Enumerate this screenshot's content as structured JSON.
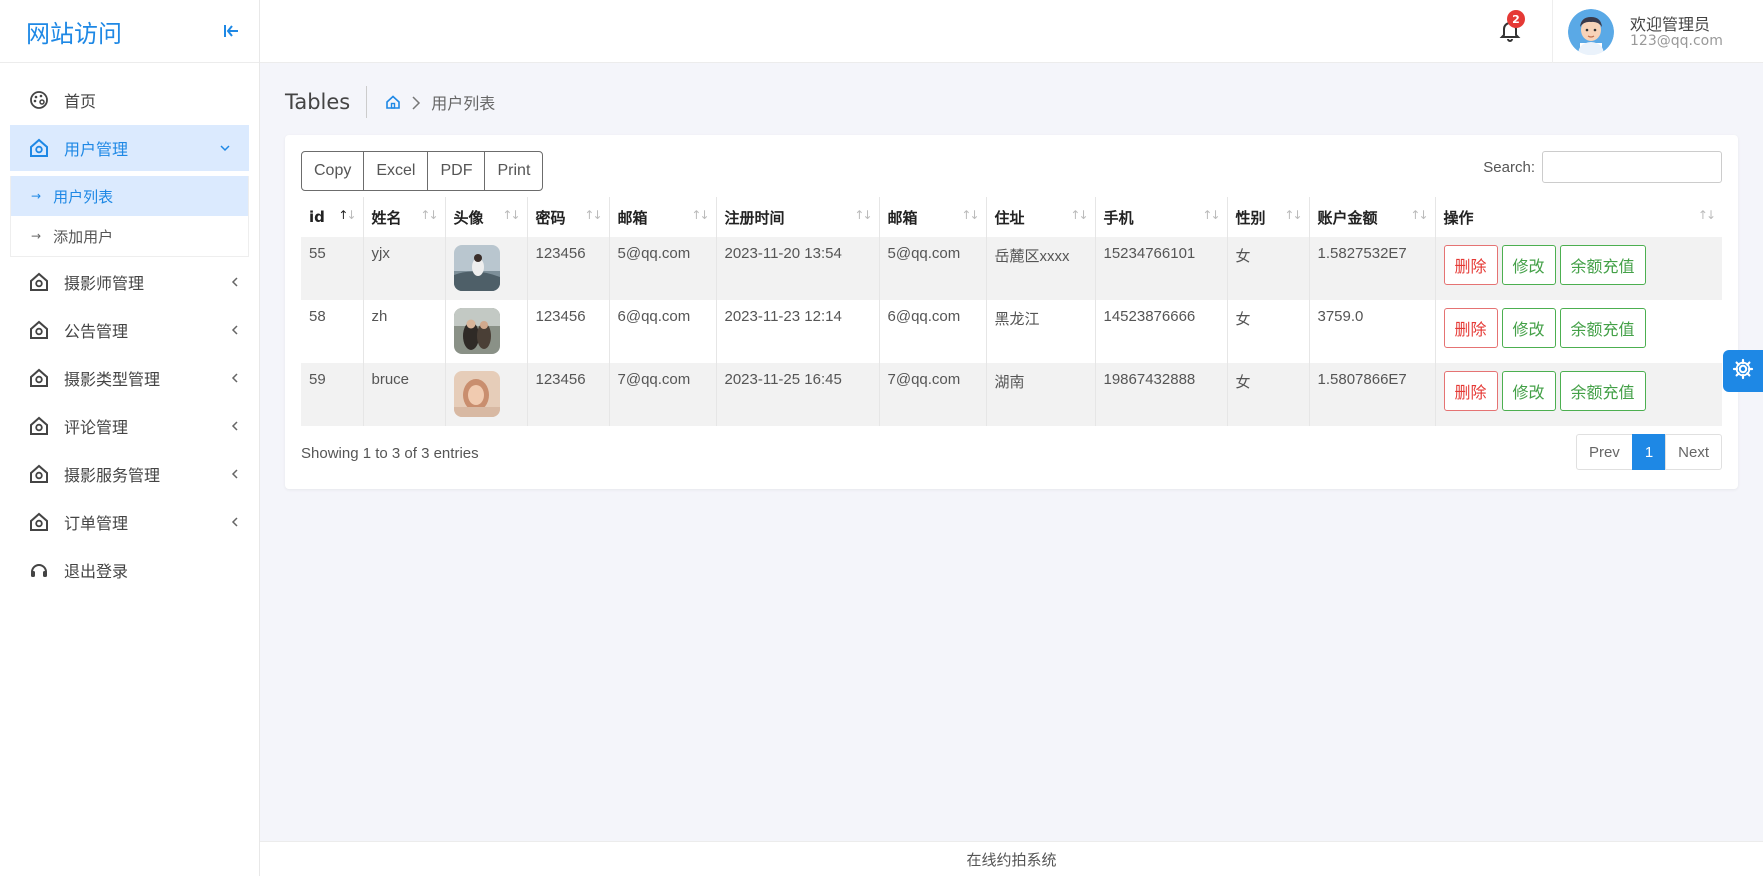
{
  "sidebar": {
    "brand": "网站访问",
    "items": [
      {
        "label": "首页",
        "icon": "palette-icon"
      },
      {
        "label": "用户管理",
        "icon": "home-icon",
        "active": true
      },
      {
        "label": "摄影师管理",
        "icon": "home-icon"
      },
      {
        "label": "公告管理",
        "icon": "home-icon"
      },
      {
        "label": "摄影类型管理",
        "icon": "home-icon"
      },
      {
        "label": "评论管理",
        "icon": "home-icon"
      },
      {
        "label": "摄影服务管理",
        "icon": "home-icon"
      },
      {
        "label": "订单管理",
        "icon": "home-icon"
      },
      {
        "label": "退出登录",
        "icon": "headset-icon"
      }
    ],
    "submenu": [
      {
        "label": "用户列表",
        "active": true
      },
      {
        "label": "添加用户"
      }
    ]
  },
  "header": {
    "notification_count": "2",
    "user_name": "欢迎管理员",
    "user_email": "123@qq.com"
  },
  "page": {
    "title": "Tables",
    "breadcrumb_current": "用户列表"
  },
  "toolbar": {
    "copy": "Copy",
    "excel": "Excel",
    "pdf": "PDF",
    "print": "Print",
    "search_label": "Search:"
  },
  "table": {
    "columns": [
      "id",
      "姓名",
      "头像",
      "密码",
      "邮箱",
      "注册时间",
      "邮箱",
      "住址",
      "手机",
      "性别",
      "账户金额",
      "操作"
    ],
    "rows": [
      {
        "id": "55",
        "name": "yjx",
        "password": "123456",
        "email": "5@qq.com",
        "reg_time": "2023-11-20 13:54",
        "email2": "5@qq.com",
        "address": "岳麓区xxxx",
        "phone": "15234766101",
        "gender": "女",
        "balance": "1.5827532E7"
      },
      {
        "id": "58",
        "name": "zh",
        "password": "123456",
        "email": "6@qq.com",
        "reg_time": "2023-11-23 12:14",
        "email2": "6@qq.com",
        "address": "黑龙江",
        "phone": "14523876666",
        "gender": "女",
        "balance": "3759.0"
      },
      {
        "id": "59",
        "name": "bruce",
        "password": "123456",
        "email": "7@qq.com",
        "reg_time": "2023-11-25 16:45",
        "email2": "7@qq.com",
        "address": "湖南",
        "phone": "19867432888",
        "gender": "女",
        "balance": "1.5807866E7"
      }
    ],
    "actions": {
      "delete": "删除",
      "edit": "修改",
      "recharge": "余额充值"
    }
  },
  "pagination": {
    "info": "Showing 1 to 3 of 3 entries",
    "prev": "Prev",
    "current": "1",
    "next": "Next"
  },
  "footer": {
    "text": "在线约拍系统"
  },
  "colors": {
    "accent": "#1e88e5",
    "danger": "#e53935",
    "success": "#43a047",
    "active_bg": "#dbeafe"
  }
}
